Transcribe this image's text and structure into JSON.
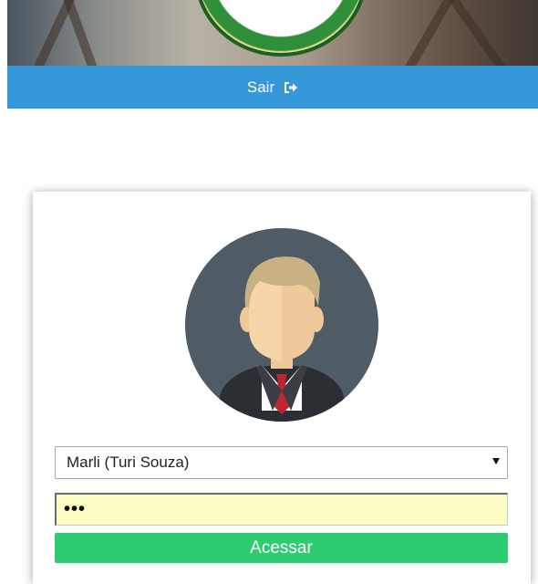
{
  "header": {
    "logout_label": "Sair",
    "logout_icon": "sign-out-icon",
    "accent_color": "#3498db"
  },
  "login": {
    "avatar_icon": "user-avatar-icon",
    "user_select": {
      "selected": "Marli (Turi Souza)"
    },
    "password": {
      "value": "•••"
    },
    "submit_label": "Acessar",
    "submit_color": "#2ecc71"
  }
}
